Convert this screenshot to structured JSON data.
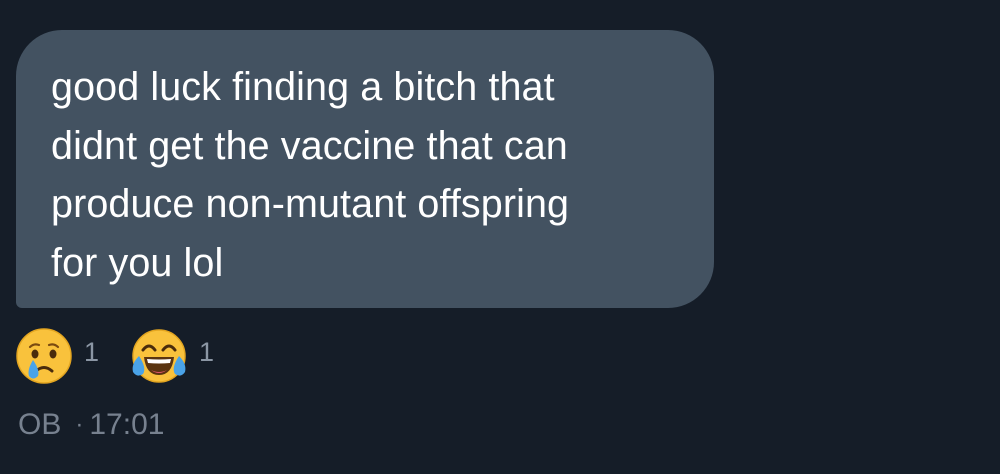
{
  "message": {
    "text": "good luck finding a bitch that\ndidnt get the vaccine that can\nproduce non-mutant offspring\nfor you lol"
  },
  "reactions": [
    {
      "icon": "crying-face-icon",
      "count": "1"
    },
    {
      "icon": "tears-of-joy-face-icon",
      "count": "1"
    }
  ],
  "meta": {
    "sender": "OB",
    "separator": "·",
    "time": "17:01"
  },
  "colors": {
    "background": "#151d28",
    "bubble": "#435261",
    "text": "#ffffff",
    "secondary_text": "#77818f"
  }
}
